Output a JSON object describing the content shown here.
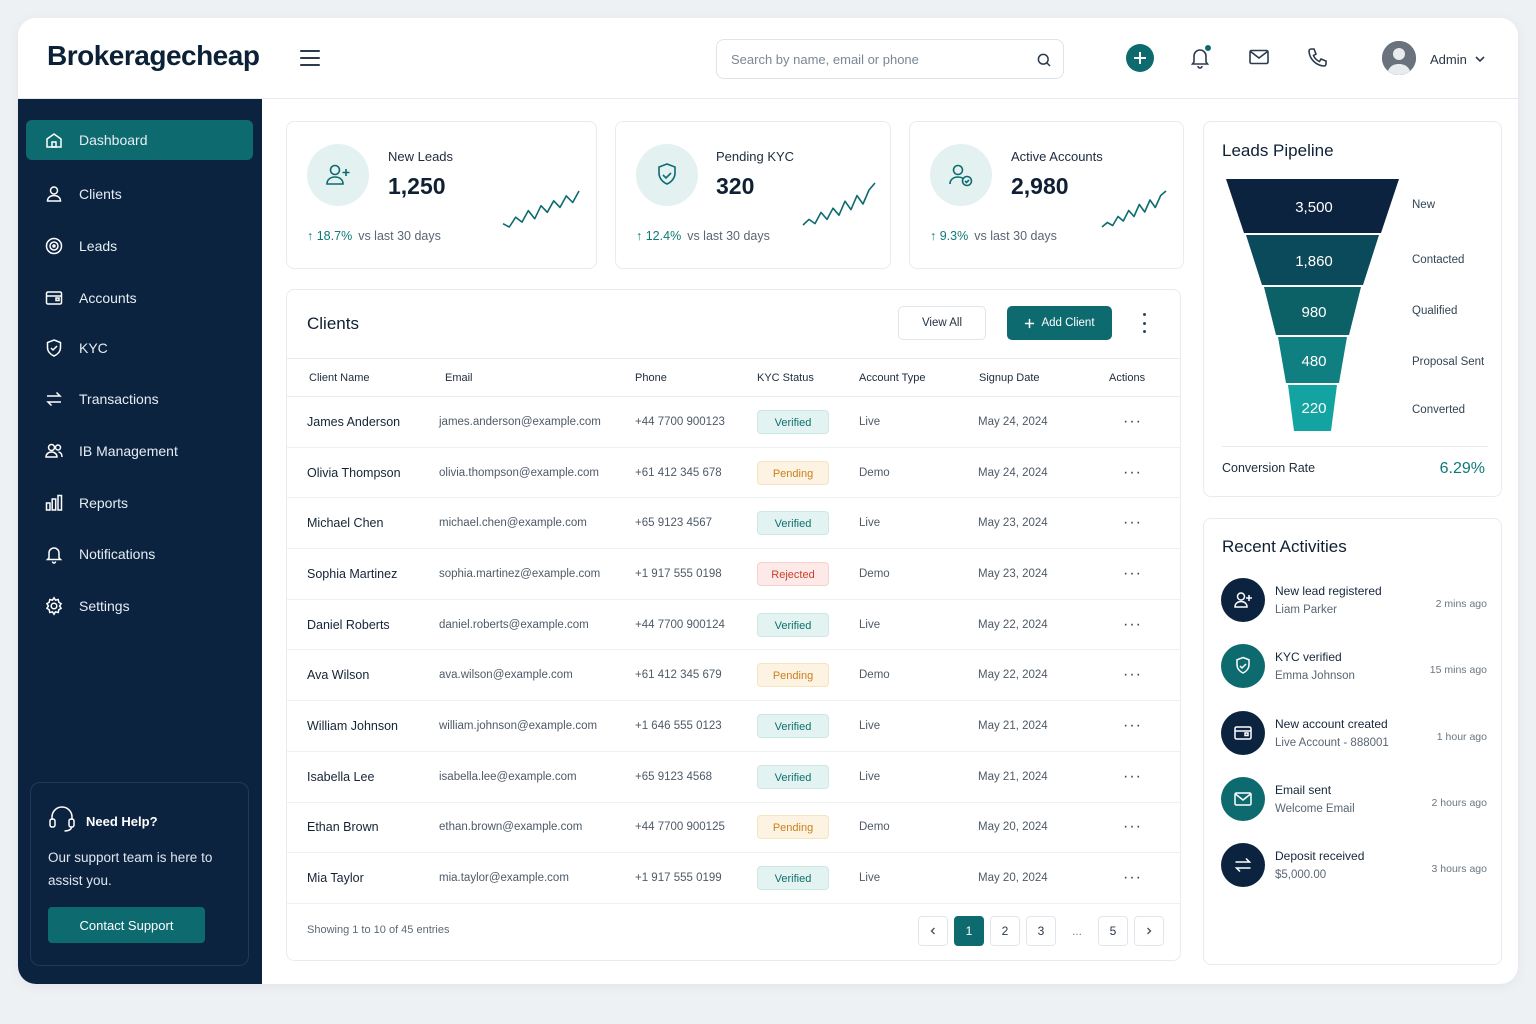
{
  "app": {
    "brand": "Brokeragecheap"
  },
  "header": {
    "search_placeholder": "Search by name, email or phone",
    "user_name": "Admin"
  },
  "sidebar": {
    "items": [
      {
        "label": "Dashboard",
        "icon": "dashboard-icon",
        "active": true
      },
      {
        "label": "Clients",
        "icon": "user-icon"
      },
      {
        "label": "Leads",
        "icon": "target-icon"
      },
      {
        "label": "Accounts",
        "icon": "wallet-icon"
      },
      {
        "label": "KYC",
        "icon": "shield-check-icon"
      },
      {
        "label": "Transactions",
        "icon": "transfer-icon"
      },
      {
        "label": "IB Management",
        "icon": "users-icon"
      },
      {
        "label": "Reports",
        "icon": "bar-chart-icon"
      },
      {
        "label": "Notifications",
        "icon": "bell-icon"
      },
      {
        "label": "Settings",
        "icon": "gear-icon"
      }
    ],
    "help": {
      "title": "Need Help?",
      "text": "Our support team is here to assist you.",
      "button": "Contact Support"
    }
  },
  "stats": [
    {
      "title": "New Leads",
      "value": "1,250",
      "change": "18.7%",
      "period": "vs last 30 days",
      "trend": [
        10,
        8,
        14,
        11,
        18,
        13,
        21,
        17,
        24,
        20,
        27,
        23,
        30
      ]
    },
    {
      "title": "Pending KYC",
      "value": "320",
      "change": "12.4%",
      "period": "vs last 30 days",
      "trend": [
        8,
        12,
        9,
        17,
        12,
        20,
        15,
        25,
        19,
        29,
        23,
        33,
        38
      ]
    },
    {
      "title": "Active Accounts",
      "value": "2,980",
      "change": "9.3%",
      "period": "vs last 30 days",
      "trend": [
        6,
        9,
        7,
        13,
        10,
        17,
        13,
        21,
        16,
        24,
        19,
        27,
        30
      ]
    }
  ],
  "clients": {
    "title": "Clients",
    "view_all": "View All",
    "add_client": "Add Client",
    "columns": [
      "Client Name",
      "Email",
      "Phone",
      "KYC Status",
      "Account Type",
      "Signup Date",
      "Actions"
    ],
    "rows": [
      {
        "name": "James Anderson",
        "email": "james.anderson@example.com",
        "phone": "+44 7700 900123",
        "kyc": "Verified",
        "type": "Live",
        "date": "May 24, 2024"
      },
      {
        "name": "Olivia Thompson",
        "email": "olivia.thompson@example.com",
        "phone": "+61 412 345 678",
        "kyc": "Pending",
        "type": "Demo",
        "date": "May 24, 2024"
      },
      {
        "name": "Michael Chen",
        "email": "michael.chen@example.com",
        "phone": "+65 9123 4567",
        "kyc": "Verified",
        "type": "Live",
        "date": "May 23, 2024"
      },
      {
        "name": "Sophia Martinez",
        "email": "sophia.martinez@example.com",
        "phone": "+1 917 555 0198",
        "kyc": "Rejected",
        "type": "Demo",
        "date": "May 23, 2024"
      },
      {
        "name": "Daniel Roberts",
        "email": "daniel.roberts@example.com",
        "phone": "+44 7700 900124",
        "kyc": "Verified",
        "type": "Live",
        "date": "May 22, 2024"
      },
      {
        "name": "Ava Wilson",
        "email": "ava.wilson@example.com",
        "phone": "+61 412 345 679",
        "kyc": "Pending",
        "type": "Demo",
        "date": "May 22, 2024"
      },
      {
        "name": "William Johnson",
        "email": "william.johnson@example.com",
        "phone": "+1 646 555 0123",
        "kyc": "Verified",
        "type": "Live",
        "date": "May 21, 2024"
      },
      {
        "name": "Isabella Lee",
        "email": "isabella.lee@example.com",
        "phone": "+65 9123 4568",
        "kyc": "Verified",
        "type": "Live",
        "date": "May 21, 2024"
      },
      {
        "name": "Ethan Brown",
        "email": "ethan.brown@example.com",
        "phone": "+44 7700 900125",
        "kyc": "Pending",
        "type": "Demo",
        "date": "May 20, 2024"
      },
      {
        "name": "Mia Taylor",
        "email": "mia.taylor@example.com",
        "phone": "+1 917 555 0199",
        "kyc": "Verified",
        "type": "Live",
        "date": "May 20, 2024"
      }
    ],
    "footer": "Showing 1 to 10 of 45 entries",
    "pages": [
      "1",
      "2",
      "3",
      "...",
      "5"
    ],
    "current_page": "1"
  },
  "pipeline": {
    "title": "Leads Pipeline",
    "stages": [
      {
        "value": "3,500",
        "label": "New"
      },
      {
        "value": "1,860",
        "label": "Contacted"
      },
      {
        "value": "980",
        "label": "Qualified"
      },
      {
        "value": "480",
        "label": "Proposal Sent"
      },
      {
        "value": "220",
        "label": "Converted"
      }
    ],
    "conversion_label": "Conversion Rate",
    "conversion_value": "6.29%"
  },
  "activities": {
    "title": "Recent Activities",
    "items": [
      {
        "title": "New lead registered",
        "sub": "Liam Parker",
        "time": "2 mins ago",
        "icon": "user-plus-icon"
      },
      {
        "title": "KYC verified",
        "sub": "Emma Johnson",
        "time": "15 mins ago",
        "icon": "shield-check-icon"
      },
      {
        "title": "New account created",
        "sub": "Live Account - 888001",
        "time": "1 hour ago",
        "icon": "wallet-icon"
      },
      {
        "title": "Email sent",
        "sub": "Welcome Email",
        "time": "2 hours ago",
        "icon": "mail-icon"
      },
      {
        "title": "Deposit received",
        "sub": "$5,000.00",
        "time": "3 hours ago",
        "icon": "transfer-icon"
      }
    ]
  },
  "colors": {
    "sidebar_bg": "#0c2340",
    "accent": "#0d6b70",
    "positive": "#0d7a78",
    "pending": "#c9811d",
    "rejected": "#c8412f"
  }
}
